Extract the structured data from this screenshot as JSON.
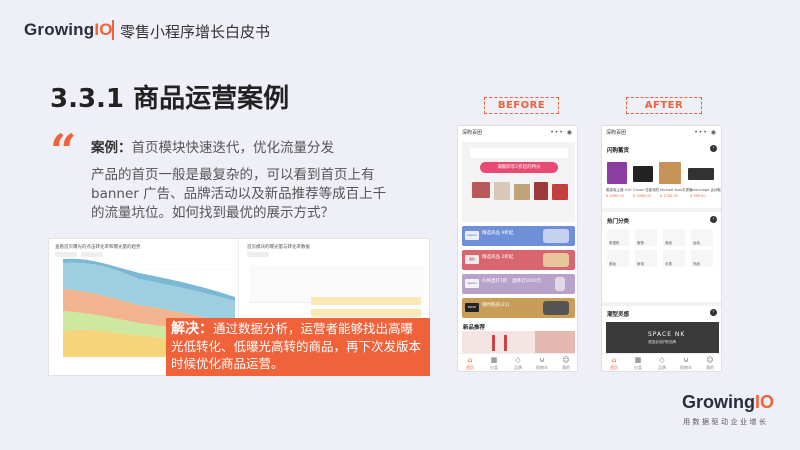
{
  "header": {
    "logo_main": "Growing",
    "logo_io": "IO",
    "title": "零售小程序增长白皮书"
  },
  "section": {
    "title": "3.3.1 商品运营案例"
  },
  "case": {
    "label": "案例：",
    "text": "首页模块快速迭代，优化流量分发",
    "description": "产品的首页一般是最复杂的，可以看到首页上有 banner 广告、品牌活动以及新品推荐等成百上千的流量坑位。如何找到最优的展示方式？"
  },
  "solution": {
    "label": "解决：",
    "text": "通过数据分析，运营者能够找出高曝光低转化、低曝光高转的商品，再下次发版本时候优化商品运营。"
  },
  "colors": {
    "accent": "#f0623a",
    "background": "#efeff8"
  },
  "before": {
    "label": "BEFORE",
    "app_name": "深煦百团",
    "banner_text": "满额即享2折起的特价",
    "strips": [
      {
        "brand": "Canon",
        "title": "精选商品 9折起"
      },
      {
        "brand": "美妆",
        "title": "精选商品 2折起"
      },
      {
        "brand": "dyson",
        "title": "价格直打1折　直降近1000元"
      },
      {
        "brand": "BOSE",
        "title": "限时购买(21)"
      }
    ],
    "new_section": "新品推荐",
    "nav": [
      "首页",
      "分类",
      "品牌",
      "购物车",
      "我的"
    ]
  },
  "after": {
    "label": "AFTER",
    "app_name": "深煦百团",
    "section1": "闪购蓄货",
    "products": [
      {
        "name": "戴森吸尘器 V10",
        "price": "¥ 2999.00"
      },
      {
        "name": "Canon 佳能相机",
        "price": "¥ 3099.00"
      },
      {
        "name": "Michael Kors手提包",
        "price": "¥ 1700.00"
      },
      {
        "name": "Balenciaga 运动鞋",
        "price": "¥ 999.00"
      }
    ],
    "section2": "热门分类",
    "categories": [
      "电视机",
      "服饰",
      "食品",
      "运动",
      "美妆",
      "家电",
      "手表",
      "饰品"
    ],
    "section3": "潮型灵感",
    "spacek_title": "SPACE NK",
    "spacek_sub": "英国全线护肤品牌",
    "nav": [
      "首页",
      "分类",
      "品牌",
      "购物车",
      "我的"
    ]
  },
  "footer": {
    "logo_main": "Growing",
    "logo_io": "IO",
    "tagline": "用数据驱动企业增长"
  },
  "data_panels": {
    "left_title": "查看首页曝光的点击转化率和曝光量的趋势",
    "right_title": "首页模块的曝光量与转化率数据"
  }
}
